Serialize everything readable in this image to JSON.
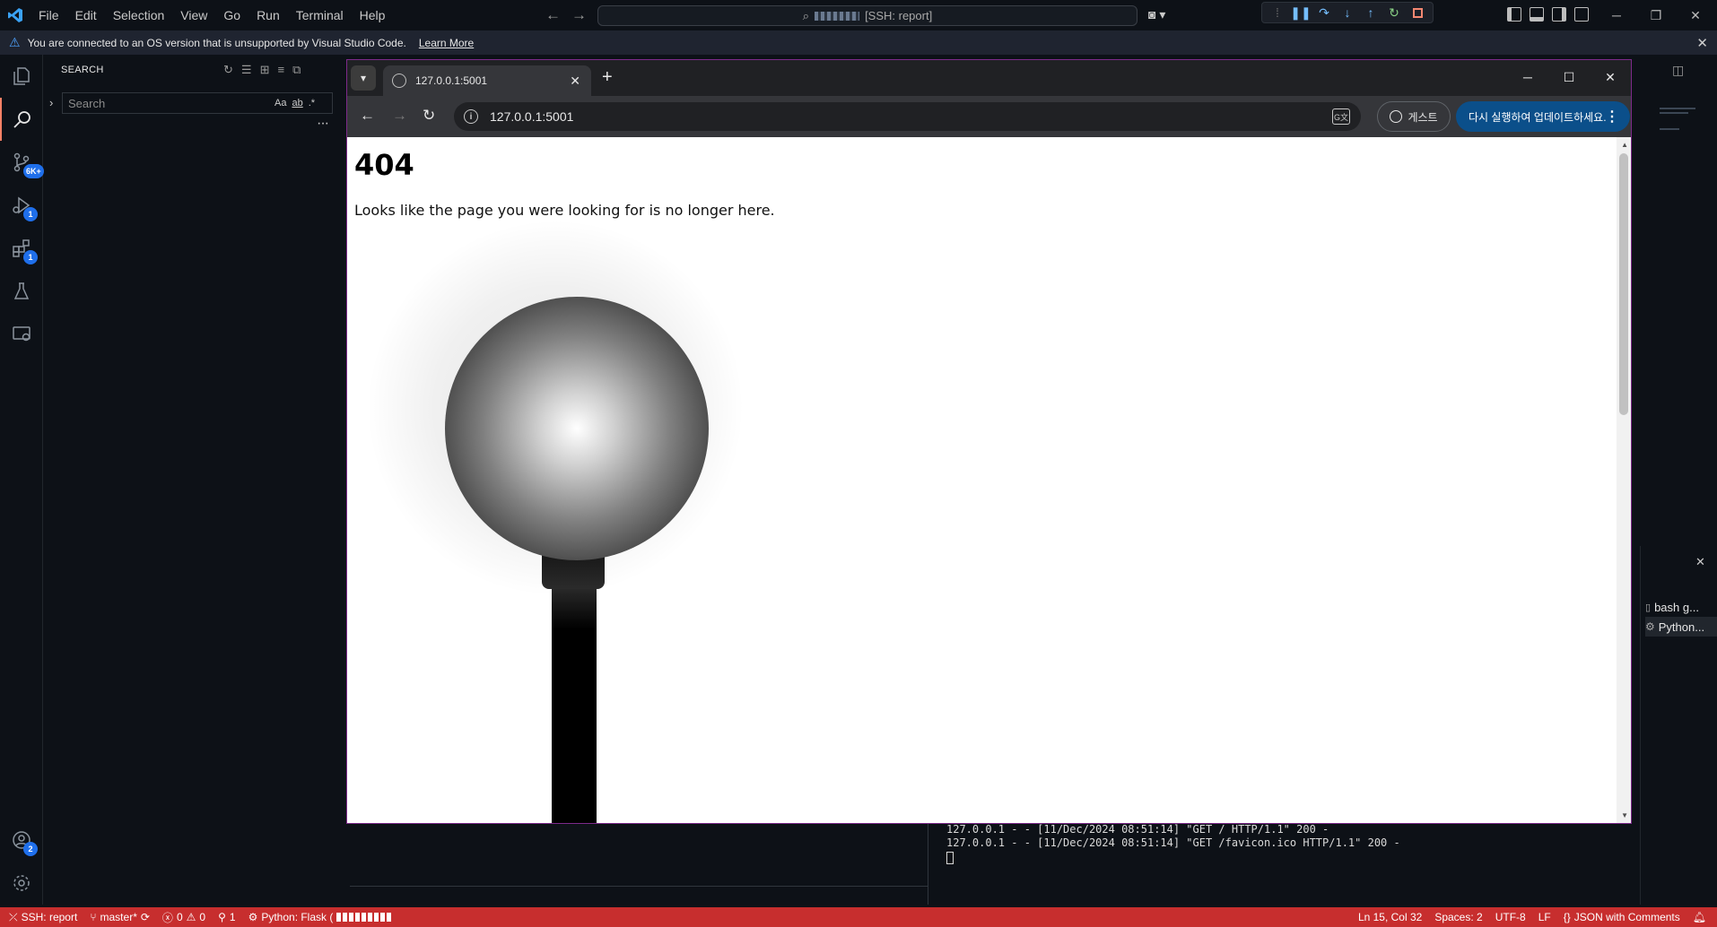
{
  "titlebar": {
    "menu": [
      "File",
      "Edit",
      "Selection",
      "View",
      "Go",
      "Run",
      "Terminal",
      "Help"
    ],
    "command_center": "[SSH: report]"
  },
  "banner": {
    "message": "You are connected to an OS version that is unsupported by Visual Studio Code.",
    "link": "Learn More"
  },
  "activitybar": {
    "badges": {
      "source_control": "6K+",
      "run_debug": "1",
      "extensions": "1",
      "accounts": "2"
    }
  },
  "sidebar": {
    "title": "SEARCH",
    "search_placeholder": "Search",
    "options": {
      "match_case": "Aa",
      "whole_word": "ab",
      "regex": ".*"
    }
  },
  "browser": {
    "tab_title": "127.0.0.1:5001",
    "url": "127.0.0.1:5001",
    "profile_label": "게스트",
    "update_label": "다시 실행하여 업데이트하세요.",
    "page": {
      "heading": "404",
      "message": "Looks like the page you were looking for is no longer here."
    }
  },
  "terminal": {
    "tabs": [
      "bash g...",
      "Python..."
    ],
    "lines": [
      "127.0.0.1 - - [11/Dec/2024 08:51:14] \"GET / HTTP/1.1\" 200 -",
      "127.0.0.1 - - [11/Dec/2024 08:51:14] \"GET /favicon.ico HTTP/1.1\" 200 -"
    ]
  },
  "statusbar": {
    "remote": "SSH: report",
    "branch": "master*",
    "errors": "0",
    "warnings": "0",
    "ports": "1",
    "run_config": "Python: Flask (",
    "cursor": "Ln 15, Col 32",
    "indent": "Spaces: 2",
    "encoding": "UTF-8",
    "eol": "LF",
    "language": "JSON with Comments"
  },
  "colors": {
    "statusbar_bg": "#c72e2e",
    "chrome_border": "#7d2a8a",
    "update_button": "#0b4f8a",
    "badge": "#1f6feb"
  }
}
